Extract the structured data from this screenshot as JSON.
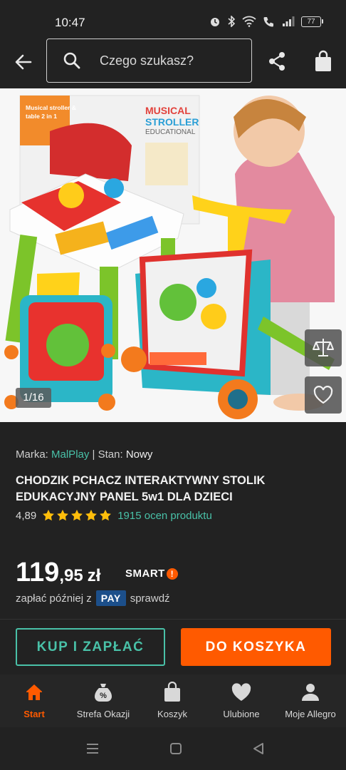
{
  "status_bar": {
    "time": "10:47",
    "battery": "77"
  },
  "search": {
    "placeholder": "Czego szukasz?"
  },
  "gallery": {
    "counter": "1/16",
    "box_text": {
      "line1": "MUSICAL",
      "line2": "STROLLER",
      "line3": "EDUCATIONAL",
      "side1": "Musical stroller &",
      "side2": "table 2 in 1"
    }
  },
  "product": {
    "brand_label": "Marka:",
    "brand": "MalPlay",
    "separator": "|",
    "condition_label": "Stan:",
    "condition": "Nowy",
    "title": "CHODZIK PCHACZ INTERAKTYWNY STOLIK EDUKACYJNY PANEL 5w1 DLA DZIECI",
    "rating": "4,89",
    "stars": 5,
    "rating_count": "1915 ocen produktu",
    "price_main": "119",
    "price_cents": ",95",
    "currency": "zł",
    "smart_label": "SMART!",
    "pay_prefix": "zapłać później z",
    "pay_badge": "PAY",
    "pay_suffix": "sprawdź"
  },
  "actions": {
    "buy_now": "KUP I ZAPŁAĆ",
    "add_to_cart": "DO KOSZYKA"
  },
  "bottom_nav": [
    {
      "label": "Start",
      "icon": "home-icon",
      "active": true
    },
    {
      "label": "Strefa Okazji",
      "icon": "deal-bag-icon",
      "active": false
    },
    {
      "label": "Koszyk",
      "icon": "cart-icon",
      "active": false
    },
    {
      "label": "Ulubione",
      "icon": "heart-icon",
      "active": false
    },
    {
      "label": "Moje Allegro",
      "icon": "user-icon",
      "active": false
    }
  ],
  "colors": {
    "accent_orange": "#ff5a00",
    "accent_teal": "#49c1a8",
    "background": "#222222"
  }
}
